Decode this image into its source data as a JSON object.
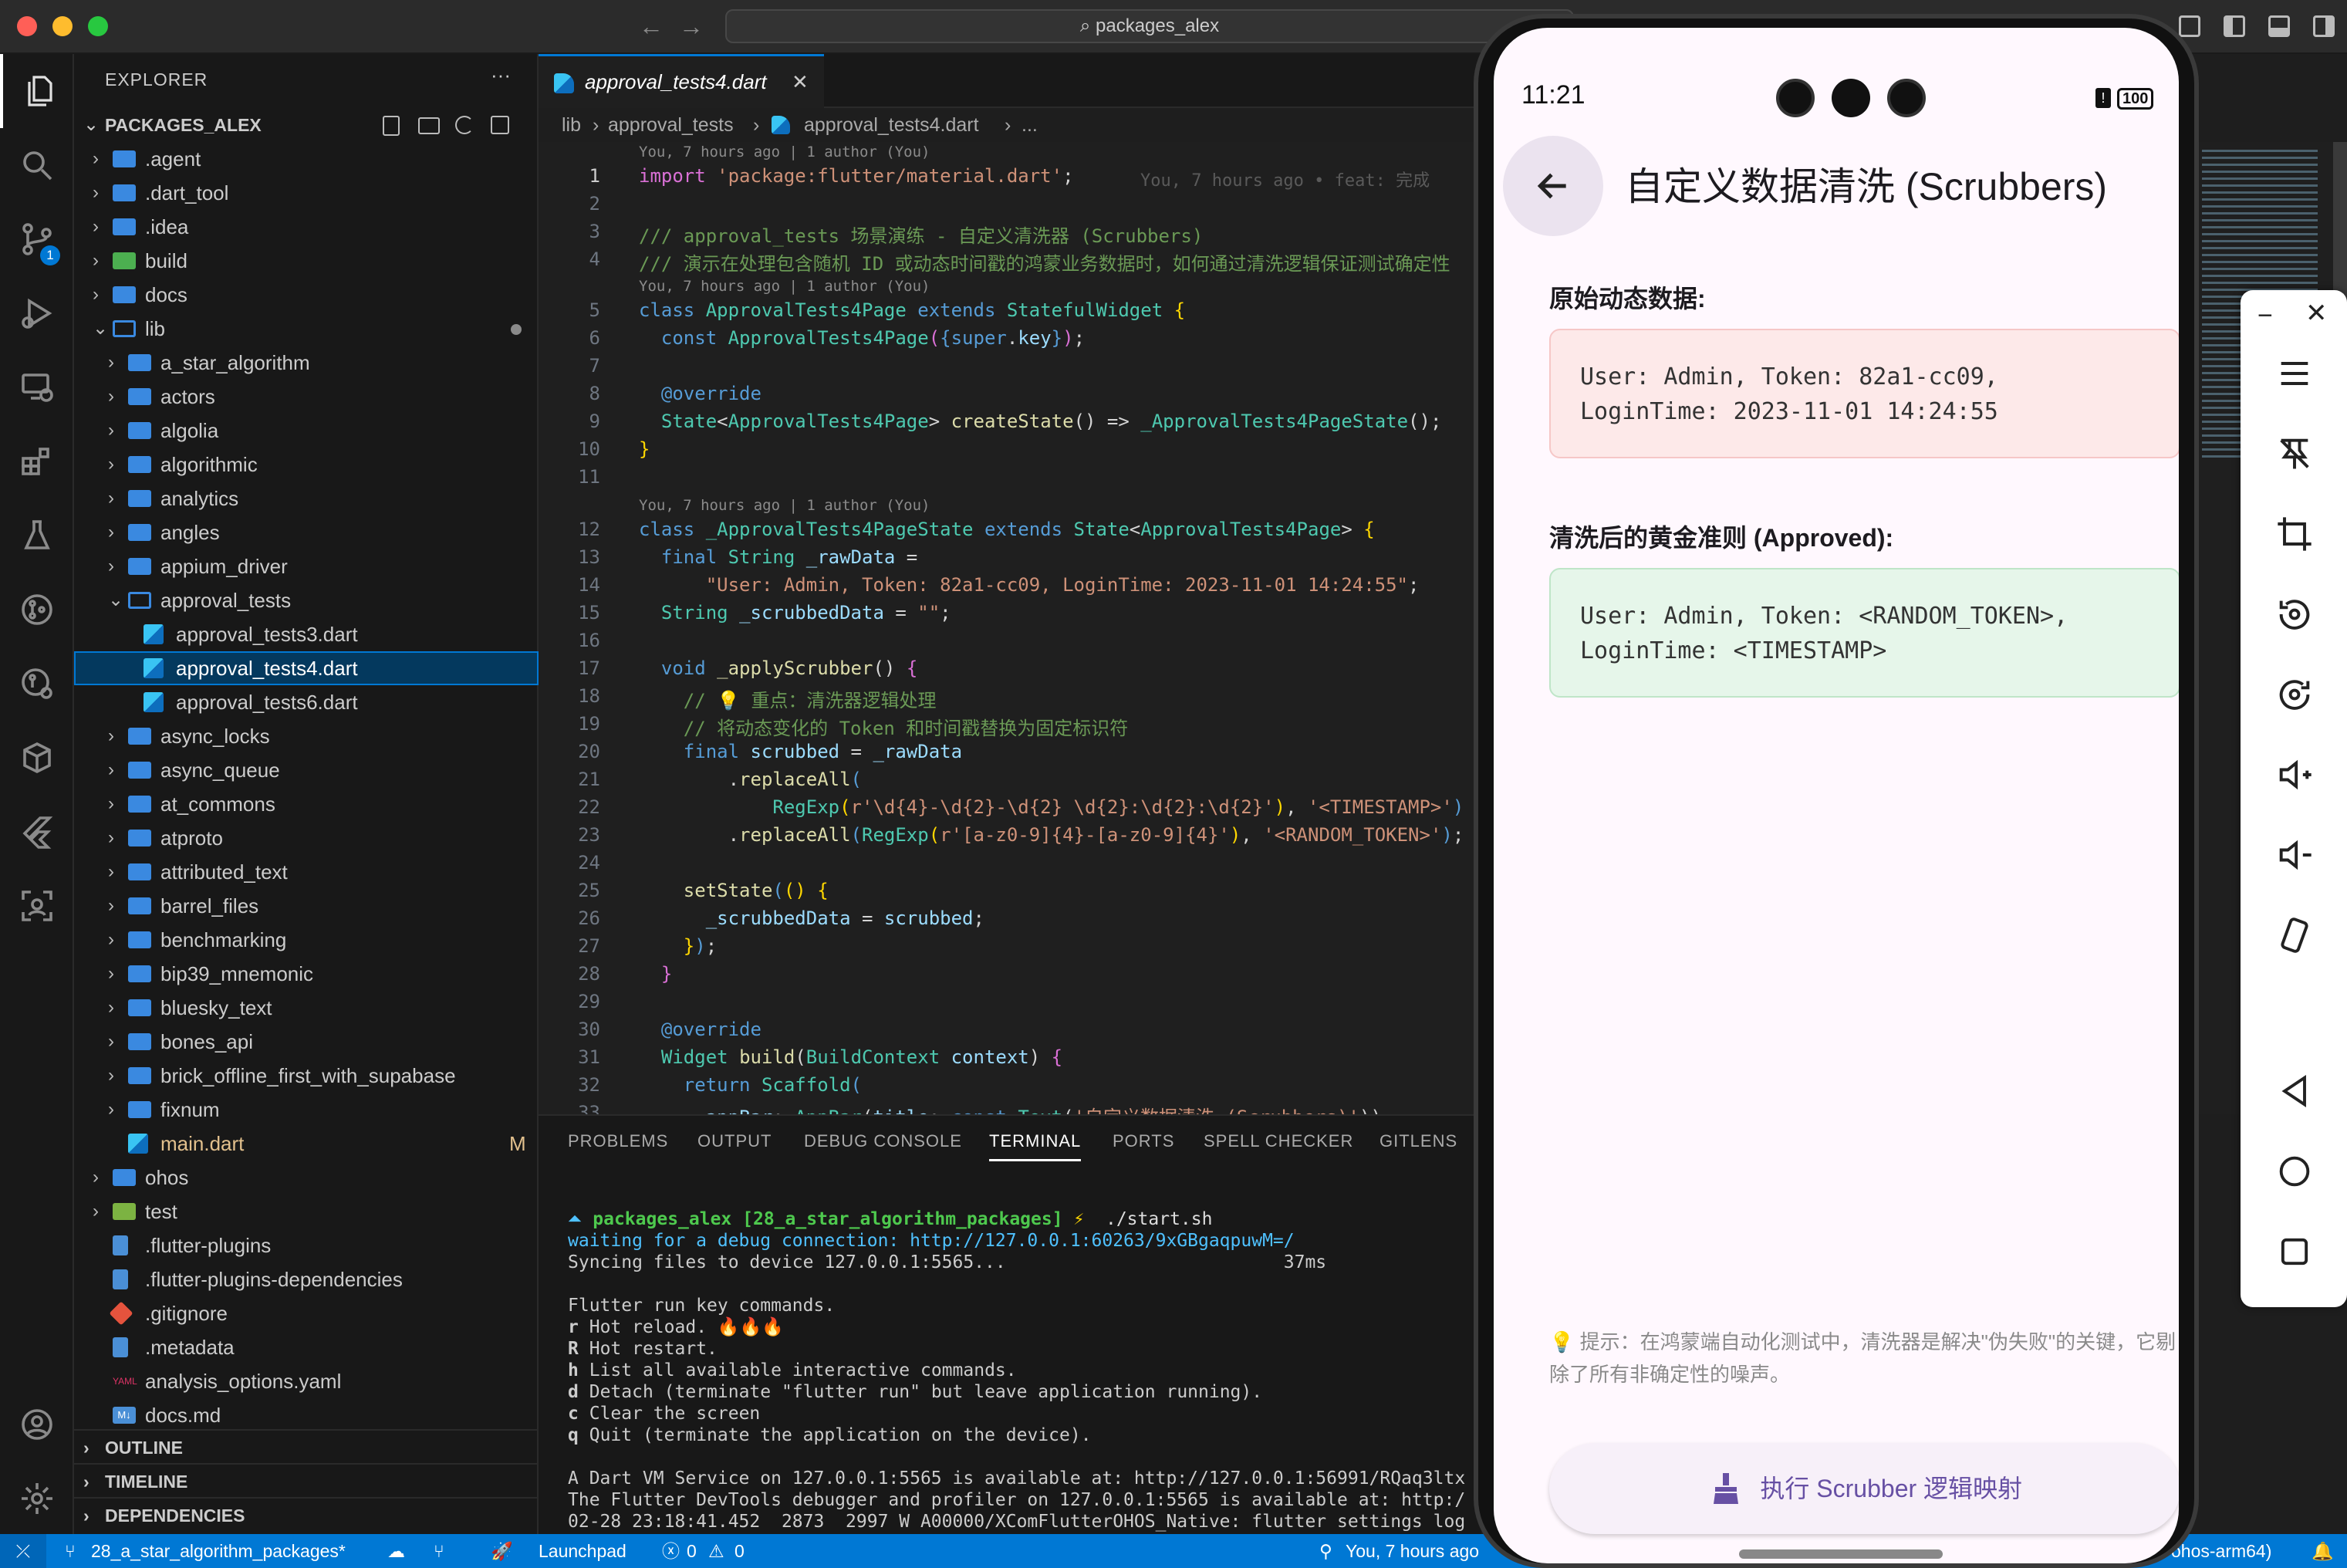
{
  "window": {
    "search": "packages_alex"
  },
  "sidebar": {
    "title": "EXPLORER",
    "menu": "···",
    "root": "PACKAGES_ALEX",
    "items": [
      {
        "label": ".agent",
        "kind": "folder",
        "depth": 0,
        "open": false
      },
      {
        "label": ".dart_tool",
        "kind": "folder",
        "depth": 0,
        "open": false
      },
      {
        "label": ".idea",
        "kind": "folder",
        "depth": 0,
        "open": false
      },
      {
        "label": "build",
        "kind": "folder",
        "depth": 0,
        "open": false
      },
      {
        "label": "docs",
        "kind": "folder",
        "depth": 0,
        "open": false
      },
      {
        "label": "lib",
        "kind": "folder",
        "depth": 0,
        "open": true
      },
      {
        "label": "a_star_algorithm",
        "kind": "folder",
        "depth": 1,
        "open": false
      },
      {
        "label": "actors",
        "kind": "folder",
        "depth": 1,
        "open": false
      },
      {
        "label": "algolia",
        "kind": "folder",
        "depth": 1,
        "open": false
      },
      {
        "label": "algorithmic",
        "kind": "folder",
        "depth": 1,
        "open": false
      },
      {
        "label": "analytics",
        "kind": "folder",
        "depth": 1,
        "open": false
      },
      {
        "label": "angles",
        "kind": "folder",
        "depth": 1,
        "open": false
      },
      {
        "label": "appium_driver",
        "kind": "folder",
        "depth": 1,
        "open": false
      },
      {
        "label": "approval_tests",
        "kind": "folder",
        "depth": 1,
        "open": true
      },
      {
        "label": "approval_tests3.dart",
        "kind": "dart",
        "depth": 2
      },
      {
        "label": "approval_tests4.dart",
        "kind": "dart",
        "depth": 2,
        "selected": true
      },
      {
        "label": "approval_tests6.dart",
        "kind": "dart",
        "depth": 2
      },
      {
        "label": "async_locks",
        "kind": "folder",
        "depth": 1,
        "open": false
      },
      {
        "label": "async_queue",
        "kind": "folder",
        "depth": 1,
        "open": false
      },
      {
        "label": "at_commons",
        "kind": "folder",
        "depth": 1,
        "open": false
      },
      {
        "label": "atproto",
        "kind": "folder",
        "depth": 1,
        "open": false
      },
      {
        "label": "attributed_text",
        "kind": "folder",
        "depth": 1,
        "open": false
      },
      {
        "label": "barrel_files",
        "kind": "folder",
        "depth": 1,
        "open": false
      },
      {
        "label": "benchmarking",
        "kind": "folder",
        "depth": 1,
        "open": false
      },
      {
        "label": "bip39_mnemonic",
        "kind": "folder",
        "depth": 1,
        "open": false
      },
      {
        "label": "bluesky_text",
        "kind": "folder",
        "depth": 1,
        "open": false
      },
      {
        "label": "bones_api",
        "kind": "folder",
        "depth": 1,
        "open": false
      },
      {
        "label": "brick_offline_first_with_supabase",
        "kind": "folder",
        "depth": 1,
        "open": false
      },
      {
        "label": "fixnum",
        "kind": "folder",
        "depth": 1,
        "open": false
      },
      {
        "label": "main.dart",
        "kind": "dart",
        "depth": 1,
        "badge": "M"
      },
      {
        "label": "ohos",
        "kind": "folder",
        "depth": 0,
        "open": false
      },
      {
        "label": "test",
        "kind": "folder",
        "depth": 0,
        "open": false
      },
      {
        "label": ".flutter-plugins",
        "kind": "file",
        "depth": 0
      },
      {
        "label": ".flutter-plugins-dependencies",
        "kind": "file",
        "depth": 0
      },
      {
        "label": ".gitignore",
        "kind": "git",
        "depth": 0
      },
      {
        "label": ".metadata",
        "kind": "file",
        "depth": 0
      },
      {
        "label": "analysis_options.yaml",
        "kind": "yaml",
        "depth": 0
      },
      {
        "label": "docs.md",
        "kind": "md",
        "depth": 0
      }
    ],
    "sections": [
      "OUTLINE",
      "TIMELINE",
      "DEPENDENCIES"
    ]
  },
  "editor": {
    "tab": "approval_tests4.dart",
    "crumb": [
      "lib",
      "approval_tests",
      "approval_tests4.dart",
      "..."
    ],
    "blames": [
      "You, 7 hours ago | 1 author (You)",
      "You, 7 hours ago | 1 author (You)",
      "You, 7 hours ago | 1 author (You)"
    ],
    "inline_blame": "You, 7 hours ago • feat: 完成"
  },
  "panel": {
    "tabs": [
      "PROBLEMS",
      "OUTPUT",
      "DEBUG CONSOLE",
      "TERMINAL",
      "PORTS",
      "SPELL CHECKER",
      "GITLENS"
    ],
    "active_tab": "TERMINAL",
    "prompt_dir": "packages_alex",
    "prompt_branch": "[28_a_star_algorithm_packages]",
    "prompt_symbol": "⚡",
    "prompt_cmd": "./start.sh",
    "waiting": "waiting for a debug connection: http://127.0.0.1:60263/9xGBgaqpuwM=/",
    "syncing": "Syncing files to device 127.0.0.1:5565...",
    "sync_time": "37ms",
    "keys_title": "Flutter run key commands.",
    "keys": [
      {
        "k": "r",
        "d": "Hot reload. 🔥🔥🔥"
      },
      {
        "k": "R",
        "d": "Hot restart."
      },
      {
        "k": "h",
        "d": "List all available interactive commands."
      },
      {
        "k": "d",
        "d": "Detach (terminate \"flutter run\" but leave application running)."
      },
      {
        "k": "c",
        "d": "Clear the screen"
      },
      {
        "k": "q",
        "d": "Quit (terminate the application on the device)."
      }
    ],
    "vm": "A Dart VM Service on 127.0.0.1:5565 is available at: http://127.0.0.1:56991/RQaq3ltx",
    "devtools": "The Flutter DevTools debugger and profiler on 127.0.0.1:5565 is available at: http:/",
    "log": "02-28 23:18:41.452  2873  2997 W A00000/XComFlutterOHOS_Native: flutter settings log"
  },
  "status": {
    "branch": "28_a_star_algorithm_packages*",
    "launch": "Launchpad",
    "errors": "0",
    "warnings": "0",
    "blame": "You, 7 hours ago",
    "platform": "ohos-arm64)"
  },
  "phone": {
    "time": "11:21",
    "battery": "100",
    "title": "自定义数据清洗 (Scrubbers)",
    "raw_label": "原始动态数据:",
    "raw_lines": [
      "User: Admin, Token: 82a1-cc09,",
      "LoginTime: 2023-11-01 14:24:55"
    ],
    "approved_label": "清洗后的黄金准则 (Approved):",
    "approved_lines": [
      "User: Admin, Token: <RANDOM_TOKEN>,",
      "LoginTime: <TIMESTAMP>"
    ],
    "hint_icon": "💡",
    "hint": "提示：在鸿蒙端自动化测试中，清洗器是解决\"伪失败\"的关键，它剔除了所有非确定性的噪声。",
    "button": "执行 Scrubber 逻辑映射",
    "colors": {
      "raw_bg": "#fde9e9",
      "approved_bg": "#e6f6ea",
      "accent": "#6750a4"
    }
  }
}
